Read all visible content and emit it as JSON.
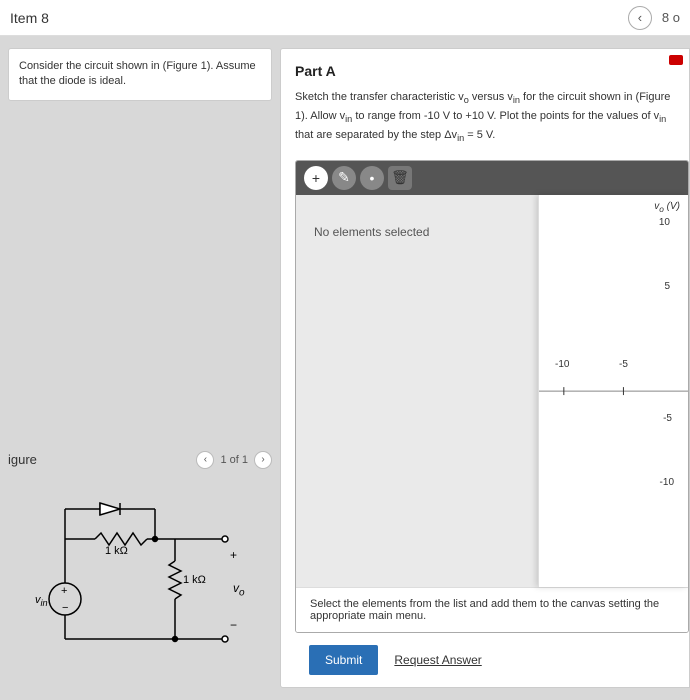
{
  "topbar": {
    "title": "Item 8",
    "counter": "8 o"
  },
  "prompt": "Consider the circuit shown in (Figure 1). Assume that the diode is ideal.",
  "figure": {
    "title": "igure",
    "pager": "1 of 1",
    "r1": "1 kΩ",
    "r2": "1 kΩ",
    "vin": "v",
    "vin_sub": "in",
    "vo": "v",
    "vo_sub": "o"
  },
  "partA": {
    "title": "Part A",
    "question_1": "Sketch the transfer characteristic v",
    "q_sub1": "o",
    "question_2": " versus v",
    "q_sub2": "in",
    "question_3": " for the circuit shown in (Figure 1). Allow v",
    "q_sub3": "in",
    "question_4": " to range from -10 V to +10 V. Plot the points for the values of v",
    "q_sub4": "in",
    "question_5": " that are separated by the step Δv",
    "q_sub5": "in",
    "question_6": " = 5 V.",
    "no_selection": "No elements selected",
    "hint": "Select the elements from the list and add them to the canvas setting the appropriate main menu.",
    "submit": "Submit",
    "request": "Request Answer",
    "ylabel": "v",
    "ylabel_sub": "o",
    "ylabel_unit": " (V)",
    "ticks": {
      "y1": "10",
      "y2": "5",
      "y3": "-5",
      "y4": "-10",
      "x1": "-10",
      "x2": "-5"
    }
  }
}
